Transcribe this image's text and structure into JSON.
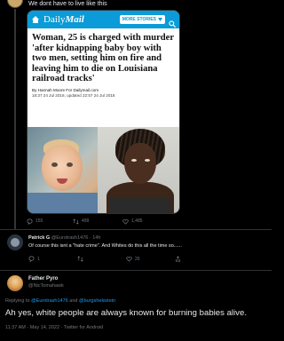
{
  "top_tweet": {
    "text": "We dont have to live like this"
  },
  "card": {
    "brand_prefix": "Daily",
    "brand_name": "Mail",
    "more_stories_label": "MORE STORIES",
    "headline": "Woman, 25 is charged with murder 'after kidnapping baby boy with two men, setting him on fire and leaving him to die on Louisiana railroad tracks'",
    "byline": "By Hannah Moore For Dailymail.com",
    "dates": "18:37 24 Jul 2018, updated 22:57 24 Jul 2018",
    "brand_color": "#0a9bd8"
  },
  "tweet_actions": {
    "replies": "155",
    "retweets": "499",
    "likes": "1,485"
  },
  "reply1": {
    "name": "Patrick G",
    "handle": "@Eurotrash1476",
    "time": "14h",
    "text": "Of course this isnt a \"hate crime\". And Whites do this all the time so......",
    "replies": "1",
    "retweets": "",
    "likes": "26"
  },
  "main_tweet": {
    "name": "Father Pyro",
    "handle": "@NicTomahawk",
    "replying_prefix": "Replying to",
    "mention1": "@Eurotrash1476",
    "and": "and",
    "mention2": "@burgshekistein",
    "text": "Ah yes, white people are always known for burning babies alive.",
    "meta": "11:37 AM · May 14, 2022 · Twitter for Android"
  },
  "colors": {
    "background": "#000000",
    "text": "#e7e9ea",
    "muted": "#71767b",
    "link": "#1d9bf0"
  }
}
